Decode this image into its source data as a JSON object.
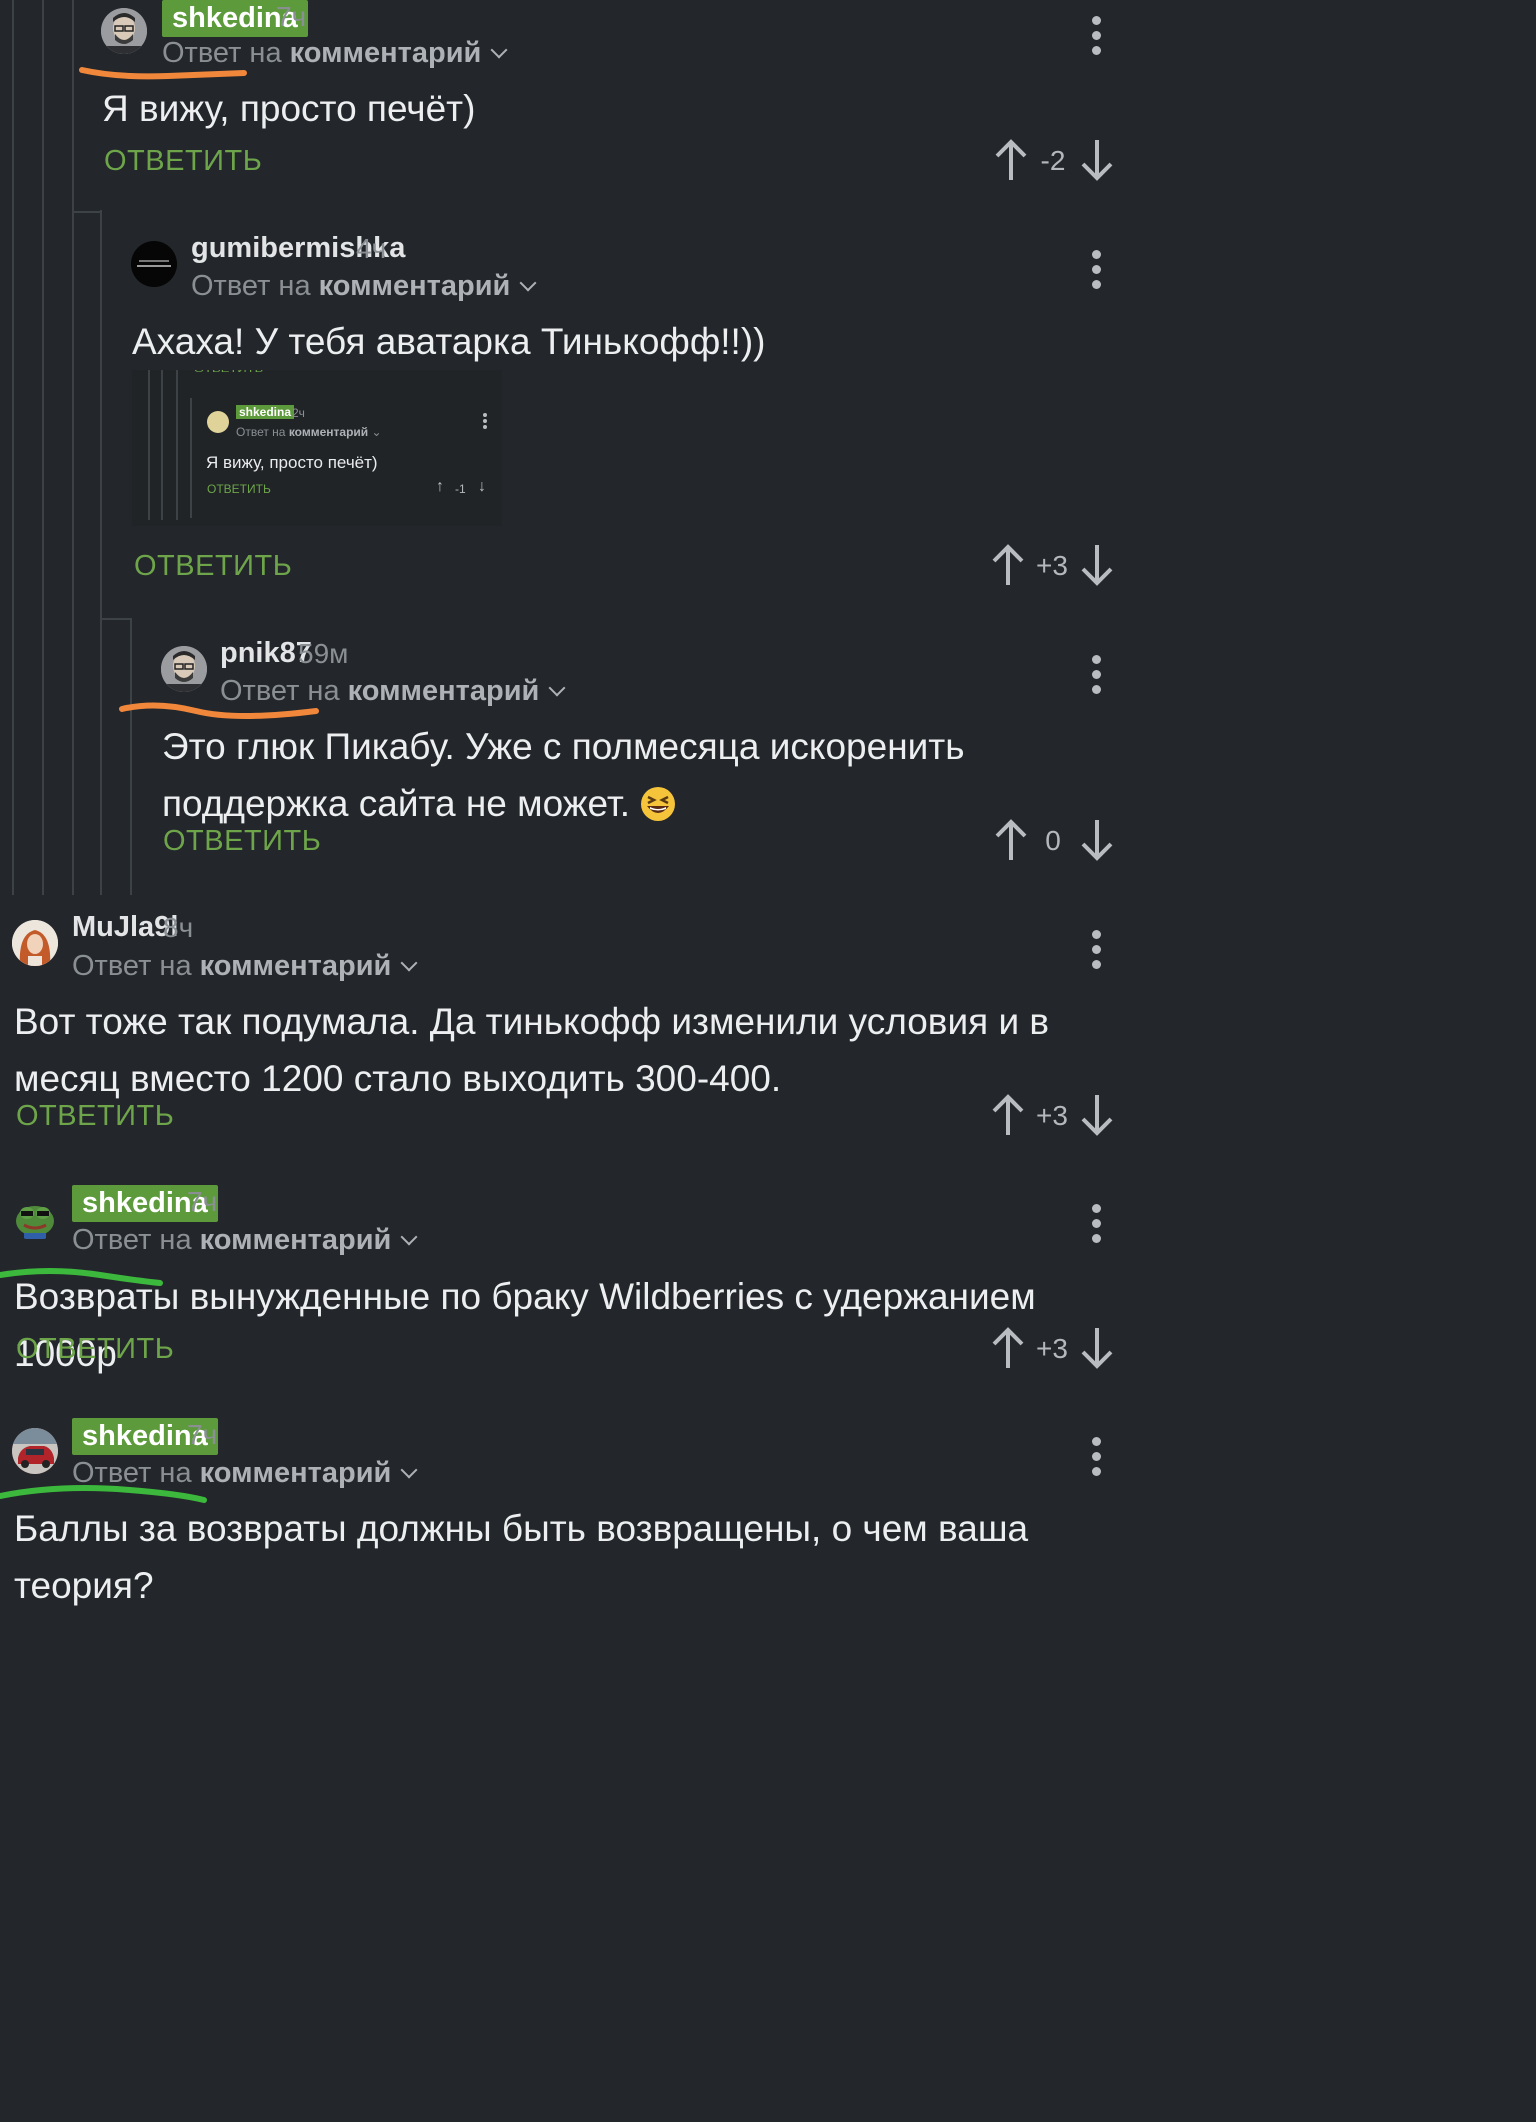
{
  "reply_to_prefix": "Ответ на",
  "reply_to_target": "комментарий",
  "reply_label": "ОТВЕТИТЬ",
  "icons": {
    "up": "arrow-up-icon",
    "down": "arrow-down-icon",
    "more": "more-vertical-icon",
    "chevron": "chevron-down-icon",
    "emoji": "laughing-emoji-icon"
  },
  "colors": {
    "background": "#23272b",
    "badge": "#5d9a3c",
    "reply_button": "#6ea54a",
    "orange_mark": "#f0873a",
    "green_mark": "#3cb83c"
  },
  "comments": [
    {
      "author": "shkedina",
      "time": "7ч",
      "text": "Я вижу, просто печёт)",
      "score": "-2"
    },
    {
      "author": "gumibermishka",
      "time": "4ч",
      "text": "Ахаха! У тебя аватарка Тинькофф!!))",
      "score": "+3",
      "embedded": {
        "author": "shkedina",
        "time": "2ч",
        "text": "Я вижу, просто печёт)",
        "score": "-1"
      }
    },
    {
      "author": "pnik87",
      "time": "59м",
      "text": "Это глюк Пикабу. Уже с полмесяца искоренить поддержка сайта не может.",
      "score": "0"
    },
    {
      "author": "MuJla9l",
      "time": "8ч",
      "text": "Вот тоже так подумала. Да тинькофф изменили условия и в месяц вместо 1200 стало выходить 300-400.",
      "score": "+3"
    },
    {
      "author": "shkedina",
      "time": "7ч",
      "text": "Возвраты вынужденные по браку Wildberries с удержанием 1000р",
      "score": "+3"
    },
    {
      "author": "shkedina",
      "time": "7ч",
      "text": "Баллы за возвраты должны быть возвращены, о чем ваша теория?"
    }
  ]
}
